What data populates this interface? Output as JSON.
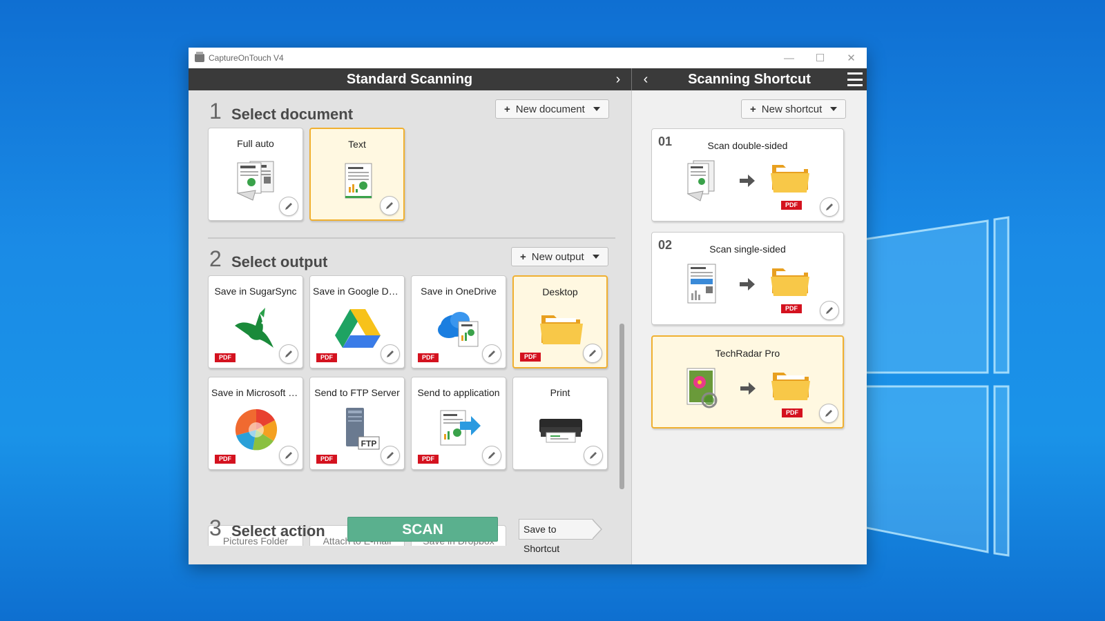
{
  "window": {
    "title": "CaptureOnTouch V4",
    "controls": {
      "minimize": "—",
      "maximize": "☐",
      "close": "✕"
    }
  },
  "header": {
    "left_title": "Standard Scanning",
    "right_title": "Scanning Shortcut",
    "chevron_right": "›",
    "chevron_left": "‹"
  },
  "step1": {
    "number": "1",
    "label": "Select document",
    "new_button": "New document",
    "tiles": [
      {
        "label": "Full auto",
        "icon": "multi-page-document-icon",
        "selected": false
      },
      {
        "label": "Text",
        "icon": "text-document-icon",
        "selected": true
      }
    ]
  },
  "step2": {
    "number": "2",
    "label": "Select output",
    "new_button": "New output",
    "tiles": [
      {
        "label": "Save in SugarSync",
        "icon": "hummingbird-icon",
        "pdf": "PDF",
        "selected": false
      },
      {
        "label": "Save in Google Dri...",
        "icon": "google-drive-icon",
        "pdf": "PDF",
        "selected": false
      },
      {
        "label": "Save in OneDrive",
        "icon": "onedrive-cloud-icon",
        "pdf": "PDF",
        "selected": false
      },
      {
        "label": "Desktop",
        "icon": "folder-icon",
        "pdf": "PDF",
        "selected": true
      },
      {
        "label": "Save in Microsoft S...",
        "icon": "sharepoint-icon",
        "pdf": "PDF",
        "selected": false
      },
      {
        "label": "Send to FTP Server",
        "icon": "ftp-server-icon",
        "pdf": "PDF",
        "selected": false
      },
      {
        "label": "Send to application",
        "icon": "send-to-app-icon",
        "pdf": "PDF",
        "selected": false
      },
      {
        "label": "Print",
        "icon": "printer-icon",
        "pdf": "",
        "selected": false
      }
    ],
    "partial_tiles": [
      "Pictures Folder",
      "Attach to E-mail",
      "Save in Dropbox"
    ],
    "ftp_text": "FTP"
  },
  "step3": {
    "number": "3",
    "label": "Select action",
    "scan_button": "SCAN",
    "save_shortcut_button": "Save to Shortcut"
  },
  "shortcuts": {
    "new_button": "New shortcut",
    "items": [
      {
        "number": "01",
        "label": "Scan double-sided",
        "pdf": "PDF",
        "selected": false
      },
      {
        "number": "02",
        "label": "Scan single-sided",
        "pdf": "PDF",
        "selected": false
      },
      {
        "number": "",
        "label": "TechRadar Pro",
        "pdf": "PDF",
        "selected": true
      }
    ]
  },
  "colors": {
    "accent_selected_border": "#f0b030",
    "selected_bg": "#fff8e1",
    "scan_green": "#5ab08e",
    "pdf_red": "#d4121f",
    "header_dark": "#3a3a3a"
  }
}
